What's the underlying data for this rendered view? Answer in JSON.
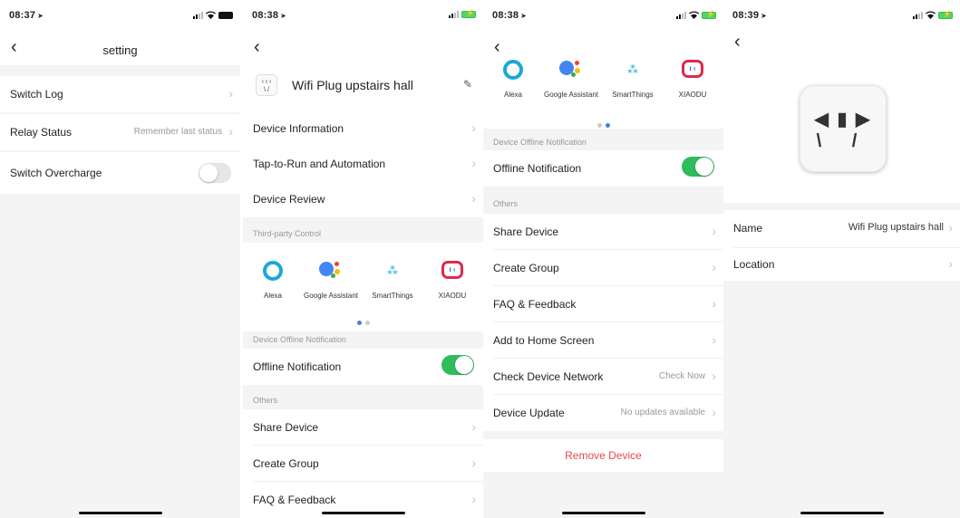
{
  "colors": {
    "toggle_on": "#2ebc5c",
    "danger": "#e8494b",
    "dot_active": "#4a7de2"
  },
  "screen1": {
    "time": "08:37",
    "title": "setting",
    "rows": [
      {
        "label": "Switch Log",
        "value": ""
      },
      {
        "label": "Relay Status",
        "value": "Remember last status"
      },
      {
        "label": "Switch Overcharge",
        "value": ""
      }
    ]
  },
  "screen2": {
    "time": "08:38",
    "device_name": "Wifi Plug upstairs hall",
    "rows": [
      {
        "label": "Device Information"
      },
      {
        "label": "Tap-to-Run and Automation"
      },
      {
        "label": "Device Review"
      }
    ],
    "third_party_label": "Third-party Control",
    "third_party": [
      "Alexa",
      "Google Assistant",
      "SmartThings",
      "XIAODU"
    ],
    "offline_section": "Device Offline Notification",
    "offline_label": "Offline Notification",
    "others_label": "Others",
    "others_rows": [
      "Share Device",
      "Create Group",
      "FAQ & Feedback"
    ]
  },
  "screen3": {
    "time": "08:38",
    "third_party": [
      "Alexa",
      "Google Assistant",
      "SmartThings",
      "XIAODU"
    ],
    "offline_section": "Device Offline Notification",
    "offline_label": "Offline Notification",
    "others_label": "Others",
    "rows": [
      {
        "label": "Share Device",
        "value": ""
      },
      {
        "label": "Create Group",
        "value": ""
      },
      {
        "label": "FAQ & Feedback",
        "value": ""
      },
      {
        "label": "Add to Home Screen",
        "value": ""
      },
      {
        "label": "Check Device Network",
        "value": "Check Now"
      },
      {
        "label": "Device Update",
        "value": "No updates available"
      }
    ],
    "remove_label": "Remove Device"
  },
  "screen4": {
    "time": "08:39",
    "rows": [
      {
        "label": "Name",
        "value": "Wifi Plug upstairs hall"
      },
      {
        "label": "Location",
        "value": ""
      }
    ]
  }
}
